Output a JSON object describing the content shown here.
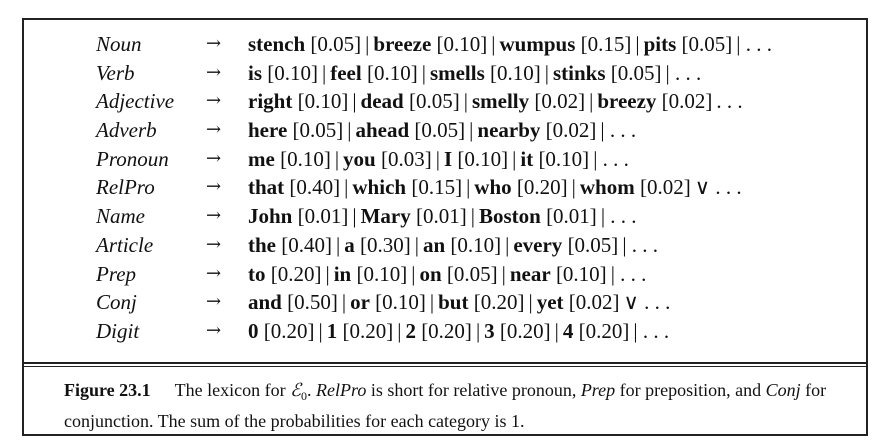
{
  "lexicon": {
    "arrow_symbol": "→",
    "separator": "|",
    "rules": [
      {
        "category": "Noun",
        "productions": [
          {
            "word": "stench",
            "prob": "[0.05]"
          },
          {
            "word": "breeze",
            "prob": "[0.10]"
          },
          {
            "word": "wumpus",
            "prob": "[0.15]"
          },
          {
            "word": "pits",
            "prob": "[0.05]"
          }
        ],
        "tail": "| . . ."
      },
      {
        "category": "Verb",
        "productions": [
          {
            "word": "is",
            "prob": "[0.10]"
          },
          {
            "word": "feel",
            "prob": "[0.10]"
          },
          {
            "word": "smells",
            "prob": "[0.10]"
          },
          {
            "word": "stinks",
            "prob": "[0.05]"
          }
        ],
        "tail": "| . . ."
      },
      {
        "category": "Adjective",
        "productions": [
          {
            "word": "right",
            "prob": "[0.10]"
          },
          {
            "word": "dead",
            "prob": "[0.05]"
          },
          {
            "word": "smelly",
            "prob": "[0.02]"
          },
          {
            "word": "breezy",
            "prob": "[0.02]"
          }
        ],
        "tail": ". . ."
      },
      {
        "category": "Adverb",
        "productions": [
          {
            "word": "here",
            "prob": "[0.05]"
          },
          {
            "word": "ahead",
            "prob": "[0.05]"
          },
          {
            "word": "nearby",
            "prob": "[0.02]"
          }
        ],
        "tail": "| . . ."
      },
      {
        "category": "Pronoun",
        "productions": [
          {
            "word": "me",
            "prob": "[0.10]"
          },
          {
            "word": "you",
            "prob": "[0.03]"
          },
          {
            "word": "I",
            "prob": "[0.10]"
          },
          {
            "word": "it",
            "prob": "[0.10]"
          }
        ],
        "tail": "| . . ."
      },
      {
        "category": "RelPro",
        "productions": [
          {
            "word": "that",
            "prob": "[0.40]"
          },
          {
            "word": "which",
            "prob": "[0.15]"
          },
          {
            "word": "who",
            "prob": "[0.20]"
          },
          {
            "word": "whom",
            "prob": "[0.02]"
          }
        ],
        "tail": "∨ . . ."
      },
      {
        "category": "Name",
        "productions": [
          {
            "word": "John",
            "prob": "[0.01]"
          },
          {
            "word": "Mary",
            "prob": "[0.01]"
          },
          {
            "word": "Boston",
            "prob": "[0.01]"
          }
        ],
        "tail": "| . . ."
      },
      {
        "category": "Article",
        "productions": [
          {
            "word": "the",
            "prob": "[0.40]"
          },
          {
            "word": "a",
            "prob": "[0.30]"
          },
          {
            "word": "an",
            "prob": "[0.10]"
          },
          {
            "word": "every",
            "prob": "[0.05]"
          }
        ],
        "tail": "| . . ."
      },
      {
        "category": "Prep",
        "productions": [
          {
            "word": "to",
            "prob": "[0.20]"
          },
          {
            "word": "in",
            "prob": "[0.10]"
          },
          {
            "word": "on",
            "prob": "[0.05]"
          },
          {
            "word": "near",
            "prob": "[0.10]"
          }
        ],
        "tail": "| . . ."
      },
      {
        "category": "Conj",
        "productions": [
          {
            "word": "and",
            "prob": "[0.50]"
          },
          {
            "word": "or",
            "prob": "[0.10]"
          },
          {
            "word": "but",
            "prob": "[0.20]"
          },
          {
            "word": "yet",
            "prob": "[0.02]"
          }
        ],
        "tail": "∨ . . ."
      },
      {
        "category": "Digit",
        "productions": [
          {
            "word": "0",
            "prob": "[0.20]"
          },
          {
            "word": "1",
            "prob": "[0.20]"
          },
          {
            "word": "2",
            "prob": "[0.20]"
          },
          {
            "word": "3",
            "prob": "[0.20]"
          },
          {
            "word": "4",
            "prob": "[0.20]"
          }
        ],
        "tail": "| . . ."
      }
    ]
  },
  "caption": {
    "label": "Figure 23.1",
    "text_1": "The lexicon for ",
    "script_e": "ℰ",
    "subscript": "0",
    "text_2": ". ",
    "relpro": "RelPro",
    "text_3": " is short for relative pronoun, ",
    "prep": "Prep",
    "text_4": " for preposition, and ",
    "conj": "Conj",
    "text_5": " for conjunction. The sum of the probabilities for each category is 1."
  }
}
